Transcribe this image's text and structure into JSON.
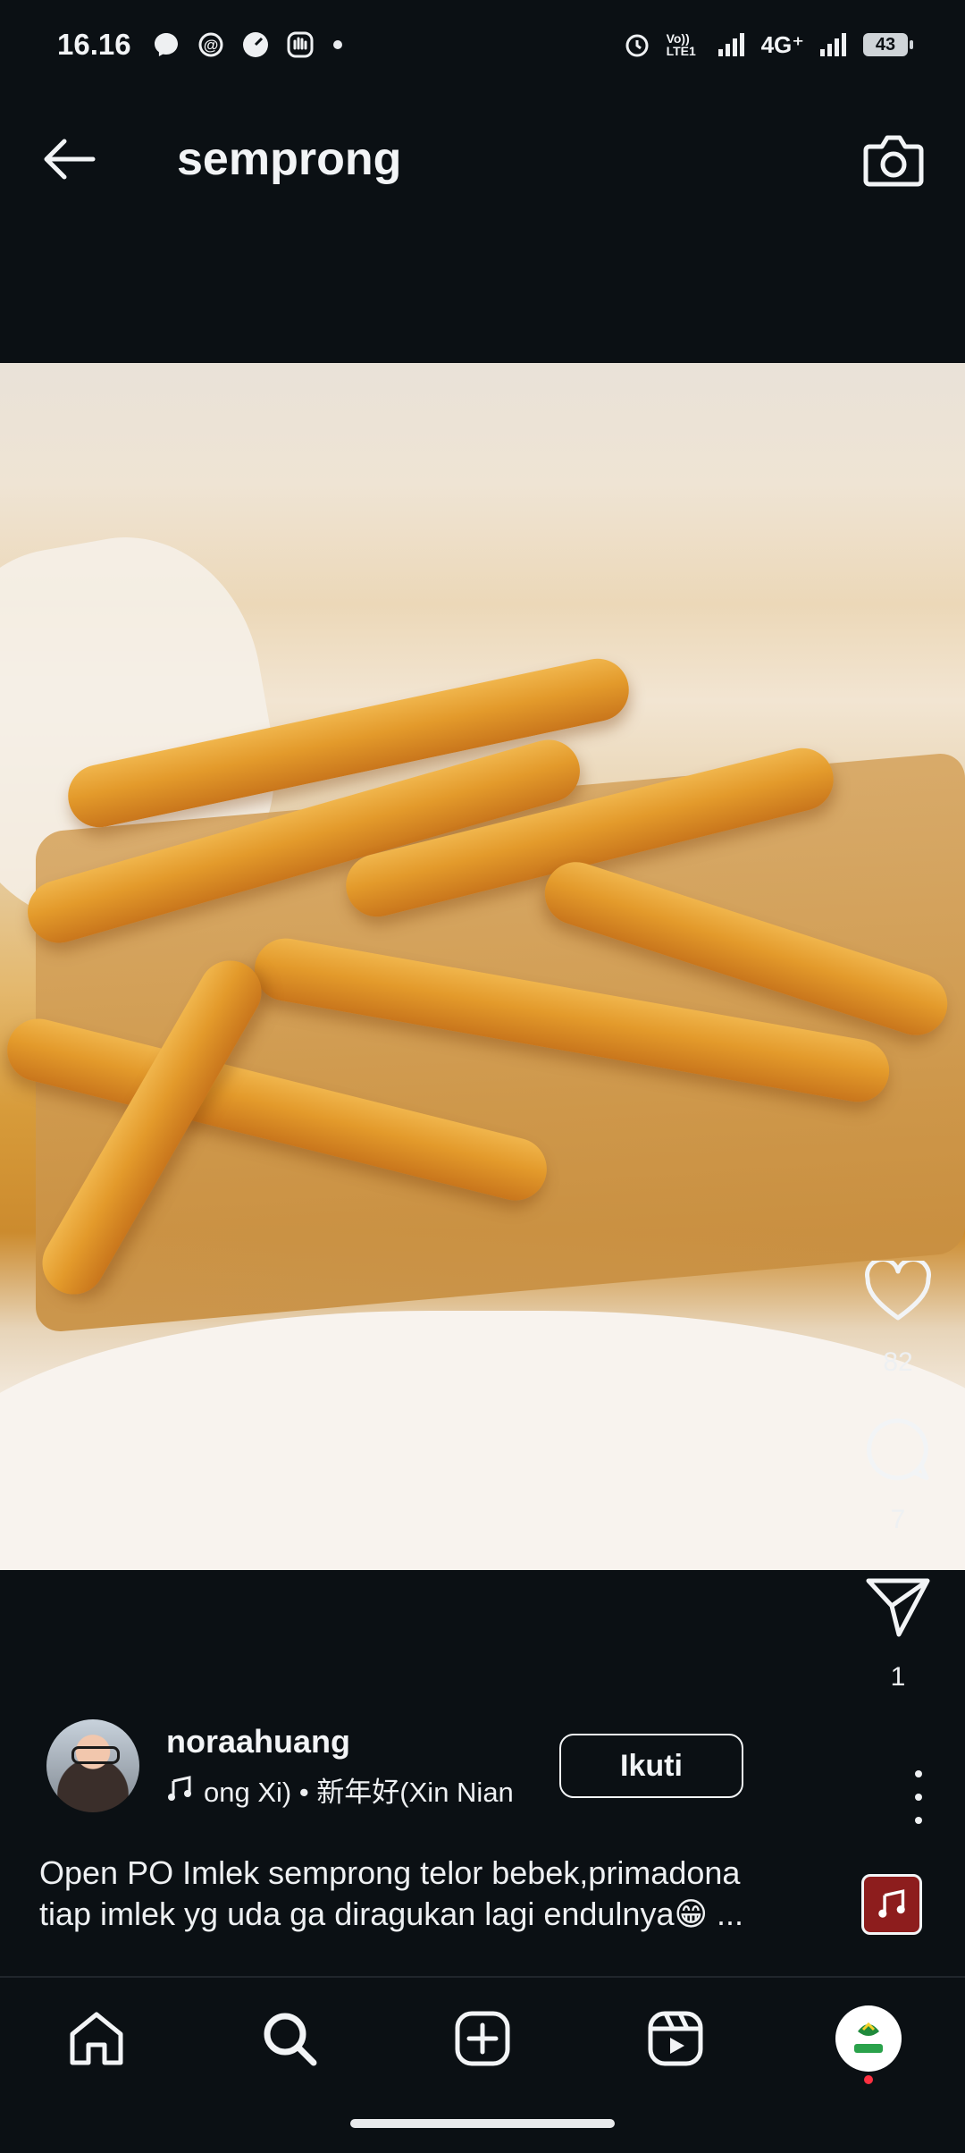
{
  "status_bar": {
    "time": "16.16",
    "network": "4G⁺",
    "volte": "Vo)) LTE1",
    "battery": "43"
  },
  "header": {
    "title": "semprong"
  },
  "post": {
    "likes": "82",
    "comments": "7",
    "shares": "1",
    "author": "noraahuang",
    "song": "ong Xi) • 新年好(Xin Nian",
    "follow_label": "Ikuti",
    "caption_line1": "Open PO Imlek semprong telor bebek,primadona",
    "caption_line2": "tiap imlek yg uda ga diragukan lagi endulnya😁 ..."
  },
  "icons": {
    "back": "arrow-left-icon",
    "camera": "camera-icon",
    "like": "heart-icon",
    "comment": "comment-icon",
    "share": "send-icon",
    "more": "more-vertical-icon",
    "home": "home-icon",
    "search": "search-icon",
    "create": "add-square-icon",
    "reels": "reels-icon",
    "profile": "profile-avatar"
  },
  "colors": {
    "background": "#0b1014",
    "text": "#f2f4f6",
    "notification_dot": "#ff3040"
  }
}
